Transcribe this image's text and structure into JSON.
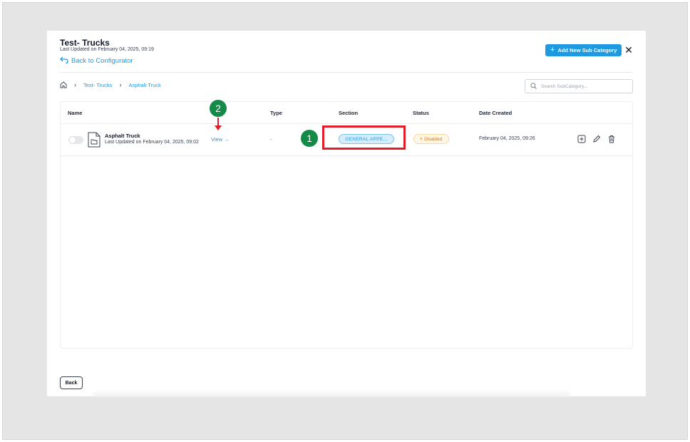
{
  "header": {
    "title": "Test- Trucks",
    "last_updated": "Last Updated on February 04, 2025, 09:19",
    "back_label": "Back to Configurator",
    "add_button_label": "Add New Sub Category",
    "close_icon": "close-icon"
  },
  "breadcrumb": {
    "home_icon": "home-icon",
    "items": [
      "Test- Trucks",
      "Asphalt Truck"
    ]
  },
  "search": {
    "placeholder": "Search SubCategory..."
  },
  "table": {
    "columns": [
      "Name",
      "Type",
      "Section",
      "Status",
      "Date Created"
    ],
    "rows": [
      {
        "name": "Asphalt Truck",
        "updated": "Last Updated on February 04, 2025, 09:02",
        "view_label": "View",
        "type": "-",
        "section": "GENERAL APPE...",
        "status": "Disabled",
        "date_created": "February 04, 2025, 09:26"
      }
    ]
  },
  "footer": {
    "back_button": "Back"
  },
  "annotations": {
    "marker_1": "1",
    "marker_2": "2"
  },
  "colors": {
    "accent": "#1e9ae0",
    "status_disabled": "#d97706",
    "annotation_green": "#138a47",
    "annotation_red": "#e11d2a"
  }
}
